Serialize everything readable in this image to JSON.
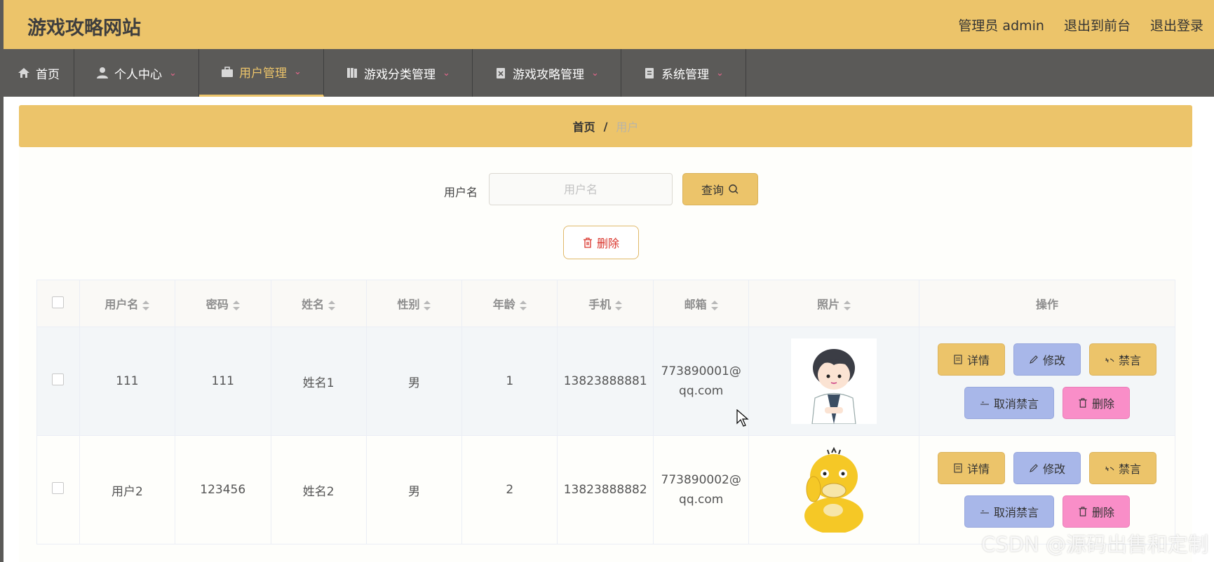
{
  "header": {
    "title": "游戏攻略网站",
    "admin_label": "管理员 admin",
    "exit_front": "退出到前台",
    "logout": "退出登录"
  },
  "nav": {
    "items": [
      {
        "label": "首页",
        "icon": "home-icon"
      },
      {
        "label": "个人中心",
        "icon": "user-icon"
      },
      {
        "label": "用户管理",
        "icon": "briefcase-icon",
        "active": true
      },
      {
        "label": "游戏分类管理",
        "icon": "book-icon"
      },
      {
        "label": "游戏攻略管理",
        "icon": "clipboard-x-icon"
      },
      {
        "label": "系统管理",
        "icon": "clipboard-icon"
      }
    ]
  },
  "breadcrumb": {
    "home": "首页",
    "sep": "/",
    "current": "用户"
  },
  "search": {
    "label": "用户名",
    "placeholder": "用户名",
    "query_label": "查询"
  },
  "toolbar": {
    "delete_label": "删除"
  },
  "table": {
    "columns": [
      "用户名",
      "密码",
      "姓名",
      "性别",
      "年龄",
      "手机",
      "邮箱",
      "照片",
      "操作"
    ],
    "rows": [
      {
        "username": "111",
        "password": "111",
        "name": "姓名1",
        "gender": "男",
        "age": "1",
        "phone": "13823888881",
        "email_line1": "773890001@",
        "email_line2": "qq.com",
        "photo": "cartoon-boy-avatar"
      },
      {
        "username": "用户2",
        "password": "123456",
        "name": "姓名2",
        "gender": "男",
        "age": "2",
        "phone": "13823888882",
        "email_line1": "773890002@",
        "email_line2": "qq.com",
        "photo": "yellow-duck-avatar"
      }
    ],
    "actions": {
      "detail": "详情",
      "edit": "修改",
      "ban": "禁言",
      "unban": "取消禁言",
      "delete": "删除"
    }
  },
  "watermark": "CSDN @源码出售和定制",
  "colors": {
    "accent": "#ecc46a",
    "nav_bg": "#5b5a58",
    "blue_btn": "#a8b7e9",
    "pink_btn": "#f98ec8",
    "danger": "#d9342b"
  }
}
